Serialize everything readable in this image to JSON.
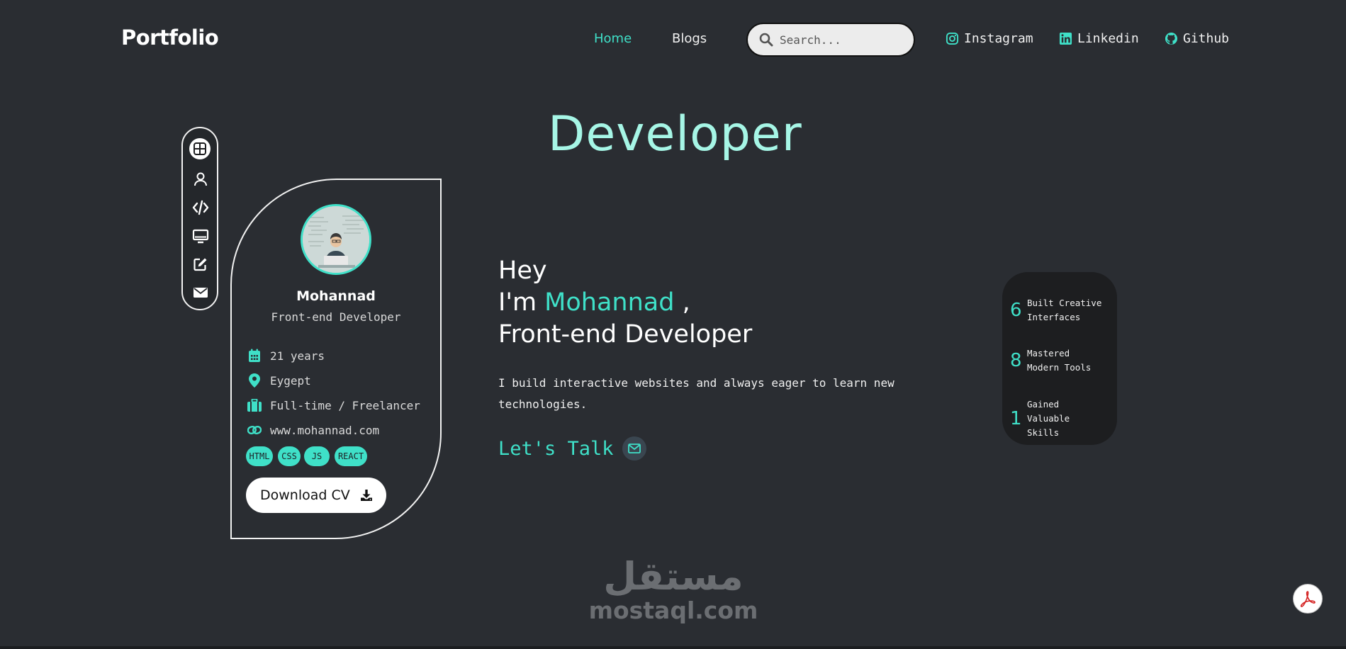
{
  "nav": {
    "logo": "Portfolio",
    "links": [
      {
        "label": "Home",
        "active": true
      },
      {
        "label": "Blogs",
        "active": false
      }
    ],
    "search_placeholder": "Search...",
    "socials": [
      {
        "label": "Instagram",
        "icon": "instagram-icon"
      },
      {
        "label": "Linkedin",
        "icon": "linkedin-icon"
      },
      {
        "label": "Github",
        "icon": "github-icon"
      }
    ]
  },
  "hero": {
    "title": "Developer"
  },
  "sidebar": {
    "items": [
      {
        "icon": "grid-icon",
        "active": true
      },
      {
        "icon": "user-icon",
        "active": false
      },
      {
        "icon": "code-icon",
        "active": false
      },
      {
        "icon": "monitor-icon",
        "active": false
      },
      {
        "icon": "edit-icon",
        "active": false
      },
      {
        "icon": "envelope-icon",
        "active": false
      }
    ]
  },
  "profile": {
    "name": "Mohannad",
    "role": "Front-end Developer",
    "info": [
      {
        "icon": "calendar-icon",
        "text": "21 years"
      },
      {
        "icon": "location-pin-icon",
        "text": "Eygept"
      },
      {
        "icon": "briefcase-icon",
        "text": "Full-time / Freelancer"
      },
      {
        "icon": "link-icon",
        "text": "www.mohannad.com"
      }
    ],
    "tags": [
      "HTML",
      "CSS",
      "JS",
      "REACT"
    ],
    "download_label": "Download CV"
  },
  "intro": {
    "line1": "Hey",
    "line2_prefix": "I'm ",
    "line2_name": "Mohannad",
    "line2_suffix": " ,",
    "line3": "Front-end Developer",
    "description": "I build interactive websites and always eager to learn new technologies.",
    "cta_label": "Let's Talk"
  },
  "stats": [
    {
      "number": "6",
      "text": "Built Creative Interfaces"
    },
    {
      "number": "8",
      "text": "Mastered Modern Tools"
    },
    {
      "number": "1",
      "text": "Gained Valuable Skills"
    }
  ],
  "watermark": {
    "arabic": "مستقل",
    "english": "mostaql.com"
  },
  "colors": {
    "background": "#2a2d32",
    "accent": "#3fe0c8",
    "title": "#a6f6e6",
    "stats_bg": "#1d1e20"
  }
}
